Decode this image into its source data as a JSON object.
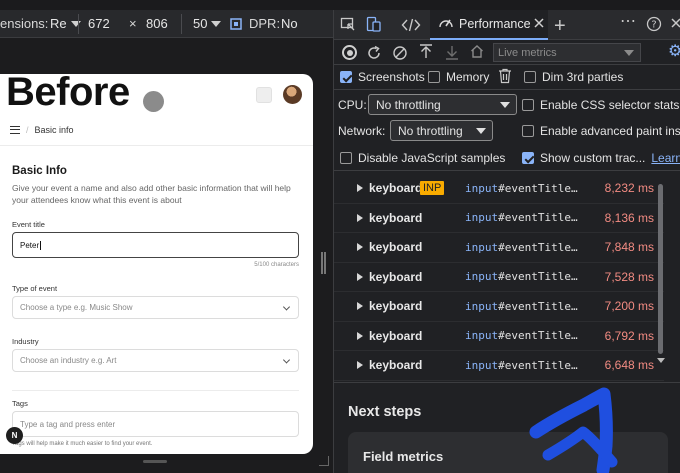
{
  "device_toolbar": {
    "dimensions_label": "ensions:",
    "device_select": "Re",
    "width": "672",
    "times": "×",
    "height": "806",
    "zoom": "50",
    "dpr_label": "DPR:",
    "dpr_value": "No"
  },
  "page": {
    "overlay_text": "Before",
    "breadcrumb": "Basic info",
    "section_title": "Basic Info",
    "section_desc": "Give your event a name and also add other basic information that will help your attendees know what this event is about",
    "event_title_label": "Event title",
    "event_title_value": "Peter",
    "char_counter": "5/100 characters",
    "type_label": "Type of event",
    "type_placeholder": "Choose a type e.g. Music Show",
    "industry_label": "Industry",
    "industry_placeholder": "Choose an industry e.g. Art",
    "tags_label": "Tags",
    "tags_placeholder": "Type a tag and press enter",
    "tags_hint": "Tags will help make it much easier to find your event.",
    "n_badge": "N"
  },
  "devtools": {
    "active_tab": "Performance",
    "live_metrics": "Live metrics",
    "options": {
      "screenshots": "Screenshots",
      "memory": "Memory",
      "dim_3rd": "Dim 3rd parties",
      "cpu_label": "CPU:",
      "cpu_value": "No throttling",
      "css_stats": "Enable CSS selector stats (slo",
      "network_label": "Network:",
      "network_value": "No throttling",
      "paint_instr": "Enable advanced paint instru",
      "disable_js": "Disable JavaScript samples",
      "custom_track": "Show custom trac...",
      "learn_more": "Learn m"
    },
    "interactions": [
      {
        "type": "keyboard",
        "badge": "INP",
        "tag": "input",
        "selector": "#eventTitle…",
        "duration": "8,232 ms"
      },
      {
        "type": "keyboard",
        "badge": "",
        "tag": "input",
        "selector": "#eventTitle…",
        "duration": "8,136 ms"
      },
      {
        "type": "keyboard",
        "badge": "",
        "tag": "input",
        "selector": "#eventTitle…",
        "duration": "7,848 ms"
      },
      {
        "type": "keyboard",
        "badge": "",
        "tag": "input",
        "selector": "#eventTitle…",
        "duration": "7,528 ms"
      },
      {
        "type": "keyboard",
        "badge": "",
        "tag": "input",
        "selector": "#eventTitle…",
        "duration": "7,200 ms"
      },
      {
        "type": "keyboard",
        "badge": "",
        "tag": "input",
        "selector": "#eventTitle…",
        "duration": "6,792 ms"
      },
      {
        "type": "keyboard",
        "badge": "",
        "tag": "input",
        "selector": "#eventTitle…",
        "duration": "6,648 ms"
      }
    ],
    "next_steps": "Next steps",
    "field_metrics": "Field metrics"
  },
  "colors": {
    "accent_blue": "#8ab4f8",
    "inp_badge": "#f9ab00",
    "duration_red": "#f28b82",
    "annotation_blue": "#1f4fe0"
  }
}
